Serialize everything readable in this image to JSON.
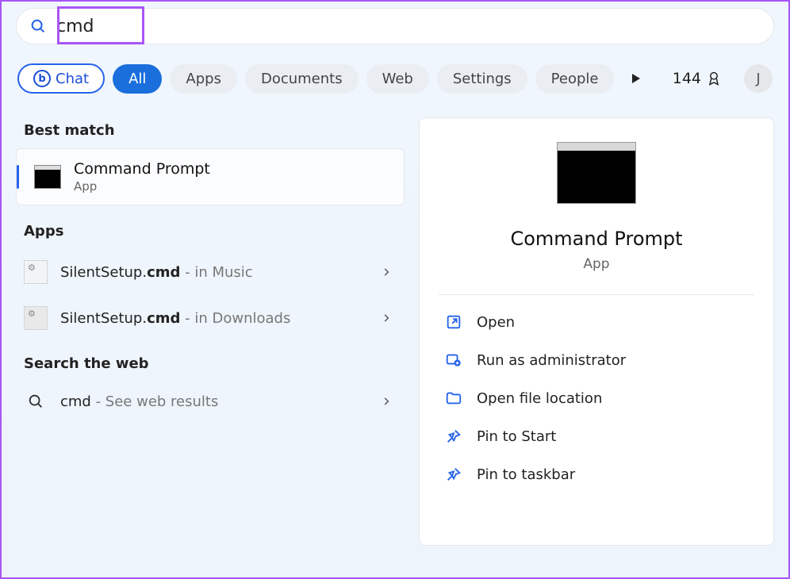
{
  "search": {
    "value": "cmd"
  },
  "filters": {
    "chat": "Chat",
    "tabs": [
      "All",
      "Apps",
      "Documents",
      "Web",
      "Settings",
      "People"
    ],
    "activeIndex": 0
  },
  "rewards": {
    "points": "144",
    "avatarInitial": "J"
  },
  "left": {
    "bestMatchHeader": "Best match",
    "bestMatch": {
      "title": "Command Prompt",
      "subtitle": "App"
    },
    "appsHeader": "Apps",
    "apps": [
      {
        "prefix": "SilentSetup.",
        "bold": "cmd",
        "location": " - in Music"
      },
      {
        "prefix": "SilentSetup.",
        "bold": "cmd",
        "location": " - in Downloads"
      }
    ],
    "webHeader": "Search the web",
    "webItem": {
      "query": "cmd",
      "hint": " - See web results"
    }
  },
  "preview": {
    "title": "Command Prompt",
    "subtitle": "App",
    "actions": [
      "Open",
      "Run as administrator",
      "Open file location",
      "Pin to Start",
      "Pin to taskbar"
    ]
  }
}
